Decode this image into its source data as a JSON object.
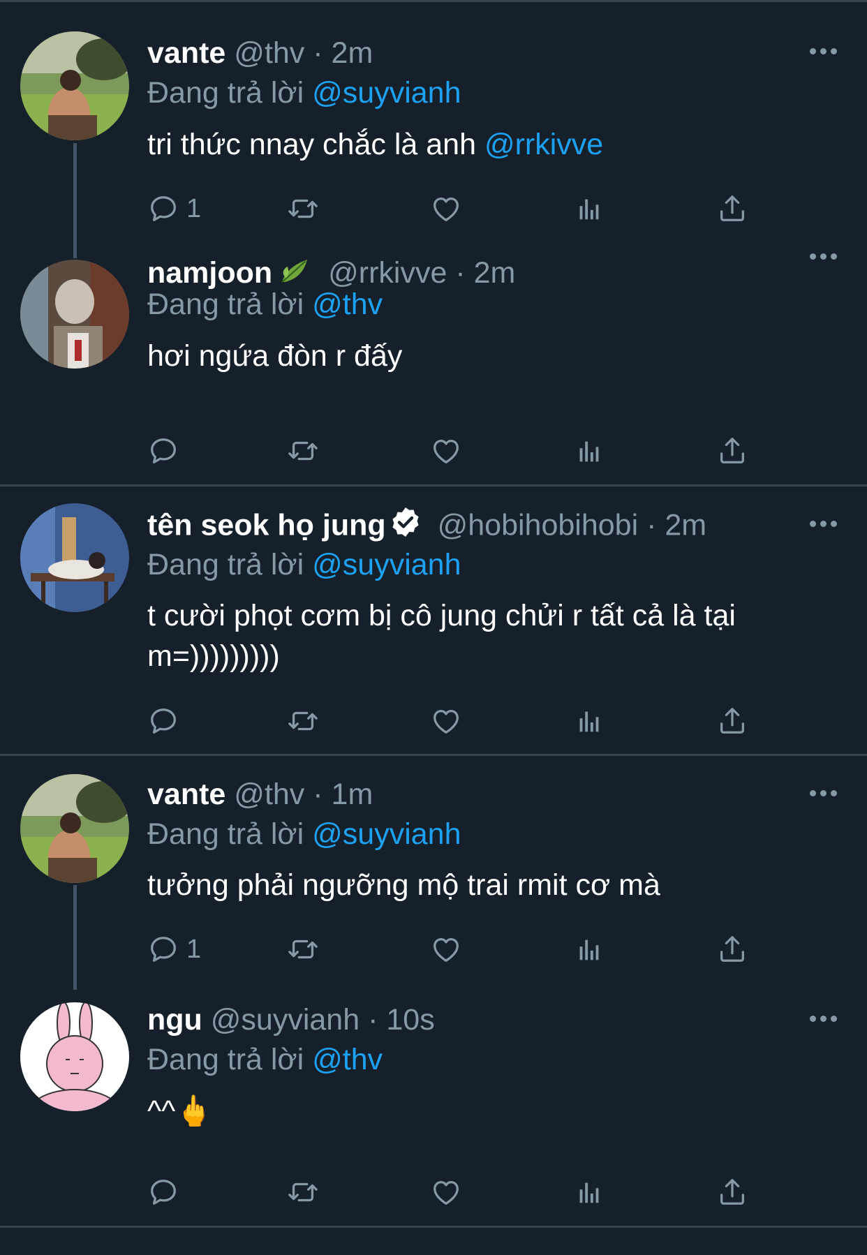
{
  "tweets": [
    {
      "name": "vante",
      "handle": "@thv",
      "time": "· 2m",
      "reply_prefix": "Đang trả lời",
      "reply_to": "@suyvianh",
      "text_main": "tri thức nnay chắc là anh",
      "text_mention": "@rrkivve",
      "reply_count": "1"
    },
    {
      "name": "namjoon",
      "name_emoji": "leaf-emoji",
      "handle": "@rrkivve",
      "time": "· 2m",
      "reply_prefix": "Đang trả lời",
      "reply_to": "@thv",
      "text_main": "hơi ngứa đòn r đấy"
    },
    {
      "name": "tên seok họ jung",
      "verified": true,
      "handle": "@hobihobihobi",
      "time": "· 2m",
      "reply_prefix": "Đang trả lời",
      "reply_to": "@suyvianh",
      "text_main": "t cười phọt cơm bị cô jung chửi r tất cả là tại m=)))))))))"
    },
    {
      "name": "vante",
      "handle": "@thv",
      "time": "· 1m",
      "reply_prefix": "Đang trả lời",
      "reply_to": "@suyvianh",
      "text_main": "tưởng phải ngưỡng mộ trai rmit cơ mà",
      "reply_count": "1"
    },
    {
      "name": "ngu",
      "handle": "@suyvianh",
      "time": "· 10s",
      "reply_prefix": "Đang trả lời",
      "reply_to": "@thv",
      "text_main": "^^🖕"
    }
  ],
  "icons": [
    "reply-icon",
    "retweet-icon",
    "like-icon",
    "analytics-icon",
    "share-icon",
    "more-icon"
  ],
  "colors": {
    "background": "#15202b",
    "muted": "#8899a6",
    "accent": "#1da1f2",
    "divider": "#38444d"
  }
}
